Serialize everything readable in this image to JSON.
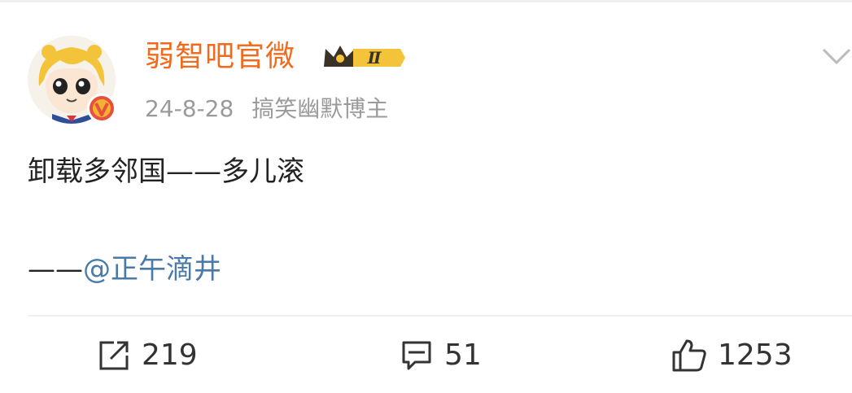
{
  "post": {
    "username": "弱智吧官微",
    "level_badge": "Ⅱ",
    "date": "24-8-28",
    "tag": "搞笑幽默博主",
    "text": "卸载多邻国——多儿滚",
    "credit_prefix": "——",
    "credit_mention": "@正午滴井"
  },
  "actions": {
    "share_count": "219",
    "comment_count": "51",
    "like_count": "1253"
  },
  "icons": {
    "avatar": "anime-girl-avatar",
    "verified": "verified-v-badge",
    "crown": "crown-level-badge",
    "more": "chevron-down-icon",
    "share": "share-icon",
    "comment": "comment-icon",
    "like": "thumbs-up-icon"
  },
  "colors": {
    "username": "#f26b1d",
    "meta": "#9a9a9a",
    "mention": "#4a7aa8",
    "text": "#222222",
    "verified": "#e6503c"
  }
}
